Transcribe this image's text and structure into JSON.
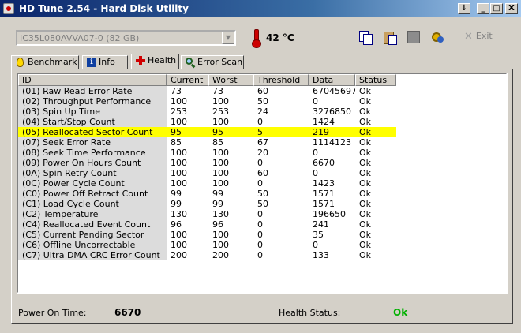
{
  "window": {
    "title": "HD Tune 2.54 - Hard Disk Utility",
    "title_buttons": [
      "↓",
      "_",
      "□",
      "X"
    ]
  },
  "toolbar": {
    "drive": "IC35L080AVVA07-0 (82 GB)",
    "temperature": "42 °C",
    "exit_label": "Exit",
    "icons": [
      "thermometer-icon",
      "copy-icon",
      "paste-icon",
      "save-icon",
      "options-icon",
      "exit-icon"
    ]
  },
  "tabs": [
    {
      "label": "Benchmark",
      "icon": "lightbulb-icon"
    },
    {
      "label": "Info",
      "icon": "info-icon"
    },
    {
      "label": "Health",
      "icon": "health-cross-icon",
      "active": true
    },
    {
      "label": "Error Scan",
      "icon": "magnifier-icon"
    }
  ],
  "table": {
    "columns": [
      "ID",
      "Current",
      "Worst",
      "Threshold",
      "Data",
      "Status"
    ],
    "rows": [
      [
        "(01) Raw Read Error Rate",
        "73",
        "73",
        "60",
        "67045697",
        "Ok"
      ],
      [
        "(02) Throughput Performance",
        "100",
        "100",
        "50",
        "0",
        "Ok"
      ],
      [
        "(03) Spin Up Time",
        "253",
        "253",
        "24",
        "3276850",
        "Ok"
      ],
      [
        "(04) Start/Stop Count",
        "100",
        "100",
        "0",
        "1424",
        "Ok"
      ],
      [
        "(05) Reallocated Sector Count",
        "95",
        "95",
        "5",
        "219",
        "Ok"
      ],
      [
        "(07) Seek Error Rate",
        "85",
        "85",
        "67",
        "1114123",
        "Ok"
      ],
      [
        "(08) Seek Time Performance",
        "100",
        "100",
        "20",
        "0",
        "Ok"
      ],
      [
        "(09) Power On Hours Count",
        "100",
        "100",
        "0",
        "6670",
        "Ok"
      ],
      [
        "(0A) Spin Retry Count",
        "100",
        "100",
        "60",
        "0",
        "Ok"
      ],
      [
        "(0C) Power Cycle Count",
        "100",
        "100",
        "0",
        "1423",
        "Ok"
      ],
      [
        "(C0) Power Off Retract Count",
        "99",
        "99",
        "50",
        "1571",
        "Ok"
      ],
      [
        "(C1) Load Cycle Count",
        "99",
        "99",
        "50",
        "1571",
        "Ok"
      ],
      [
        "(C2) Temperature",
        "130",
        "130",
        "0",
        "196650",
        "Ok"
      ],
      [
        "(C4) Reallocated Event Count",
        "96",
        "96",
        "0",
        "241",
        "Ok"
      ],
      [
        "(C5) Current Pending Sector",
        "100",
        "100",
        "0",
        "35",
        "Ok"
      ],
      [
        "(C6) Offline Uncorrectable",
        "100",
        "100",
        "0",
        "0",
        "Ok"
      ],
      [
        "(C7) Ultra DMA CRC Error Count",
        "200",
        "200",
        "0",
        "133",
        "Ok"
      ]
    ],
    "highlight_row": 4,
    "highlight_color": "#ffff00"
  },
  "status": {
    "power_on_label": "Power On Time:",
    "power_on_value": "6670",
    "health_label": "Health Status:",
    "health_value": "Ok",
    "health_color": "#00b000"
  }
}
